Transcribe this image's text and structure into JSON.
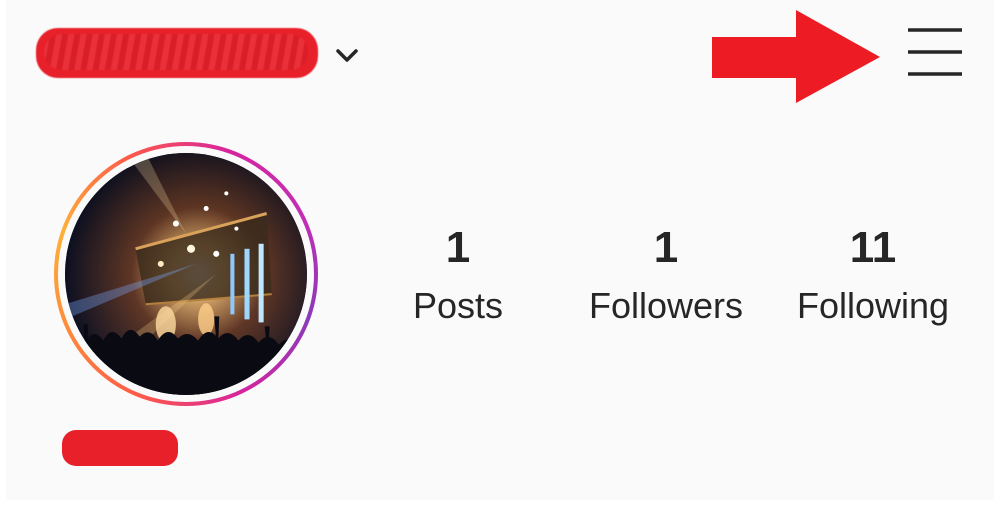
{
  "header": {
    "username_redacted": true,
    "dropdown_icon": "chevron-down-icon",
    "menu_icon": "hamburger-menu-icon",
    "annotation_arrow_color": "#ed1c24"
  },
  "profile": {
    "avatar_description": "concert-stage-photo",
    "ring_colors": [
      "#d6249f",
      "#8a3ab9",
      "#fd5949",
      "#fdb03a"
    ],
    "display_name_redacted": true
  },
  "stats": [
    {
      "value": "1",
      "label": "Posts"
    },
    {
      "value": "1",
      "label": "Followers"
    },
    {
      "value": "11",
      "label": "Following"
    }
  ]
}
